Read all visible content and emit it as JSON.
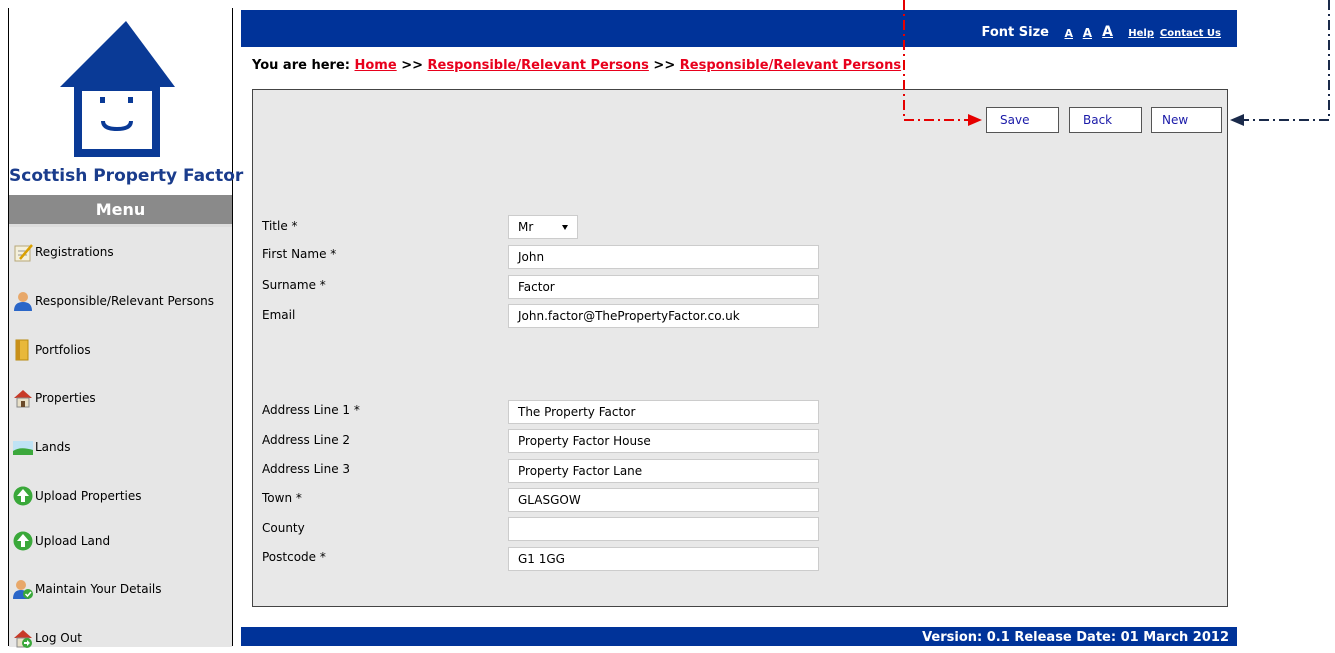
{
  "logo": {
    "text": "Scottish Property Factor",
    "color": "#1a3c8c"
  },
  "menu": {
    "title": "Menu",
    "items": [
      {
        "label": "Registrations",
        "icon": "notepad-pencil-icon"
      },
      {
        "label": "Responsible/Relevant Persons",
        "icon": "person-icon"
      },
      {
        "label": "Portfolios",
        "icon": "folder-icon"
      },
      {
        "label": "Properties",
        "icon": "house-icon"
      },
      {
        "label": "Lands",
        "icon": "landscape-icon"
      },
      {
        "label": "Upload Properties",
        "icon": "green-up-arrow-icon"
      },
      {
        "label": "Upload Land",
        "icon": "green-up-arrow-icon"
      },
      {
        "label": "Maintain Your Details",
        "icon": "person-check-icon"
      },
      {
        "label": "Log Out",
        "icon": "house-exit-icon"
      }
    ]
  },
  "header": {
    "font_size_label": "Font Size",
    "font_sizes": [
      "A",
      "A",
      "A"
    ],
    "help": "Help",
    "contact": "Contact Us",
    "color": "#003399"
  },
  "breadcrumb": {
    "prefix": "You are here:",
    "home": "Home",
    "sep": ">>",
    "crumb1": "Responsible/Relevant Persons",
    "crumb2": "Responsible/Relevant Persons"
  },
  "buttons": {
    "save": "Save",
    "back": "Back",
    "new": "New"
  },
  "form": {
    "title": {
      "label": "Title *",
      "value": "Mr"
    },
    "first_name": {
      "label": "First Name *",
      "value": "John"
    },
    "surname": {
      "label": "Surname *",
      "value": "Factor"
    },
    "email": {
      "label": "Email",
      "value": "John.factor@ThePropertyFactor.co.uk"
    },
    "address1": {
      "label": "Address Line 1 *",
      "value": "The Property Factor"
    },
    "address2": {
      "label": "Address Line 2",
      "value": "Property Factor House"
    },
    "address3": {
      "label": "Address Line 3",
      "value": "Property Factor Lane"
    },
    "town": {
      "label": "Town *",
      "value": "GLASGOW"
    },
    "county": {
      "label": "County",
      "value": ""
    },
    "postcode": {
      "label": "Postcode *",
      "value": "G1 1GG"
    }
  },
  "footer": {
    "text": "Version: 0.1 Release Date: 01 March 2012"
  }
}
